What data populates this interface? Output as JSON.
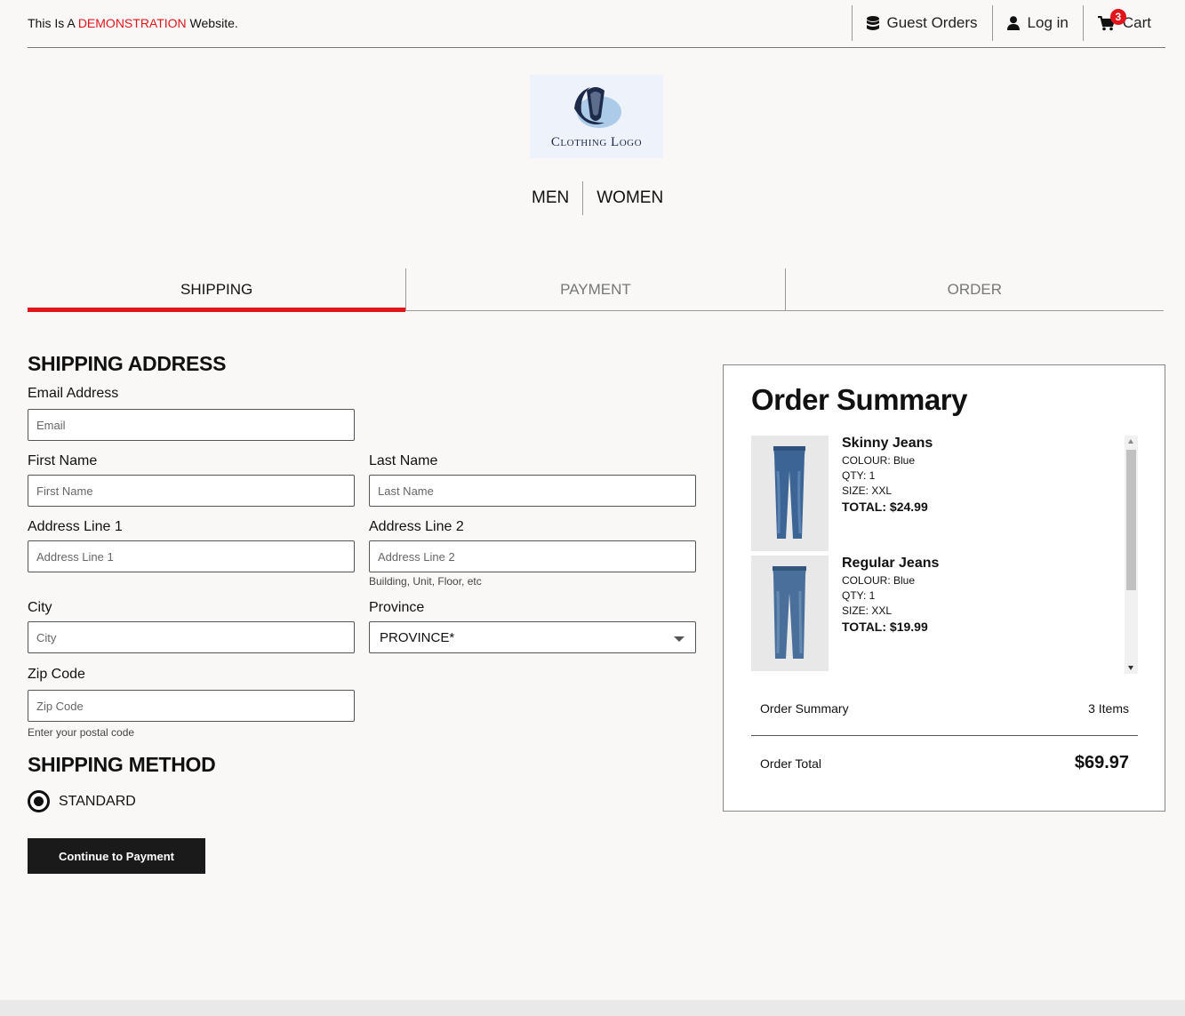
{
  "topbar": {
    "demo_prefix": "This Is A ",
    "demo_highlight": "DEMONSTRATION",
    "demo_suffix": " Website.",
    "guest_orders": "Guest Orders",
    "login": "Log in",
    "cart": "Cart",
    "cart_count": "3"
  },
  "logo": {
    "text": "Clothing Logo"
  },
  "nav": {
    "men": "MEN",
    "women": "WOMEN"
  },
  "steps": {
    "shipping": "SHIPPING",
    "payment": "PAYMENT",
    "order": "ORDER"
  },
  "form": {
    "shipping_address_title": "SHIPPING ADDRESS",
    "email_label": "Email Address",
    "email_placeholder": "Email",
    "first_name_label": "First Name",
    "first_name_placeholder": "First Name",
    "last_name_label": "Last Name",
    "last_name_placeholder": "Last Name",
    "address1_label": "Address Line 1",
    "address1_placeholder": "Address Line 1",
    "address2_label": "Address Line 2",
    "address2_placeholder": "Address Line 2",
    "address2_hint": "Building, Unit, Floor, etc",
    "city_label": "City",
    "city_placeholder": "City",
    "province_label": "Province",
    "province_value": "PROVINCE*",
    "zip_label": "Zip Code",
    "zip_placeholder": "Zip Code",
    "zip_hint": "Enter your postal code",
    "shipping_method_title": "SHIPPING METHOD",
    "method_standard": "STANDARD",
    "continue_label": "Continue to Payment"
  },
  "summary": {
    "title": "Order Summary",
    "items": [
      {
        "name": "Skinny Jeans",
        "colour": "COLOUR: Blue",
        "qty": "QTY: 1",
        "size": "SIZE: XXL",
        "total": "TOTAL: $24.99"
      },
      {
        "name": "Regular Jeans",
        "colour": "COLOUR: Blue",
        "qty": "QTY: 1",
        "size": "SIZE: XXL",
        "total": "TOTAL: $19.99"
      }
    ],
    "summary_label": "Order Summary",
    "summary_count": "3 Items",
    "total_label": "Order Total",
    "total_value": "$69.97"
  },
  "colors": {
    "accent": "#e2151b",
    "button": "#1a1a1a"
  }
}
